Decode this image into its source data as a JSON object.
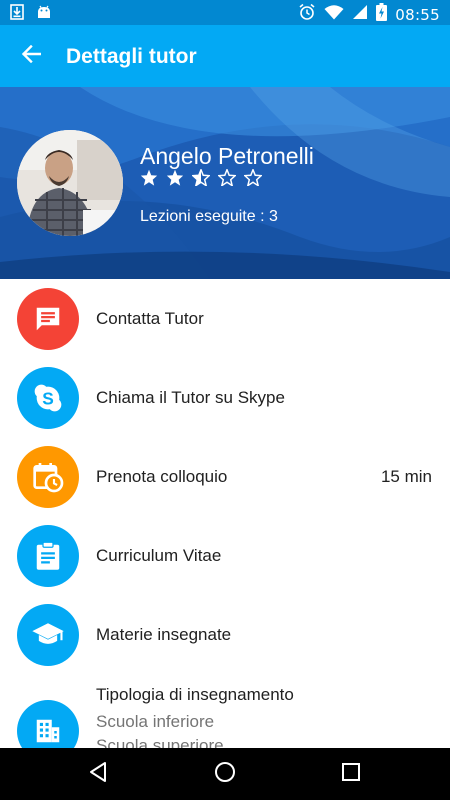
{
  "status_bar": {
    "time": "08:55",
    "battery_text": "charging",
    "left_icons": [
      "download-icon",
      "android-icon"
    ],
    "right_icons": [
      "alarm-icon",
      "wifi-icon",
      "signal-icon",
      "battery-charging-icon"
    ]
  },
  "app_bar": {
    "title": "Dettagli tutor",
    "back_icon": "arrow-back-icon"
  },
  "profile": {
    "name": "Angelo Petronelli",
    "rating": 2.5,
    "rating_max": 5,
    "lessons_text": "Lezioni eseguite : 3"
  },
  "actions": [
    {
      "label": "Contatta Tutor",
      "icon": "message-icon",
      "color": "#f44336",
      "value": ""
    },
    {
      "label": "Chiama il Tutor su Skype",
      "icon": "skype-icon",
      "color": "#03a9f4",
      "value": ""
    },
    {
      "label": "Prenota colloquio",
      "icon": "calendar-clock-icon",
      "color": "#ff9800",
      "value": "15 min"
    },
    {
      "label": "Curriculum Vitae",
      "icon": "clipboard-icon",
      "color": "#03a9f4",
      "value": ""
    },
    {
      "label": "Materie insegnate",
      "icon": "school-icon",
      "color": "#03a9f4",
      "value": ""
    }
  ],
  "teaching_type": {
    "label": "Tipologia di insegnamento",
    "icon": "building-icon",
    "color": "#03a9f4",
    "items": [
      "Scuola inferiore",
      "Scuola superiore"
    ]
  },
  "colors": {
    "status_bar": "#0288d1",
    "app_bar": "#03a9f4",
    "header_bg": "#1e63b8"
  },
  "nav_bar": {
    "icons": [
      "back-triangle-icon",
      "home-circle-icon",
      "recents-square-icon"
    ]
  }
}
